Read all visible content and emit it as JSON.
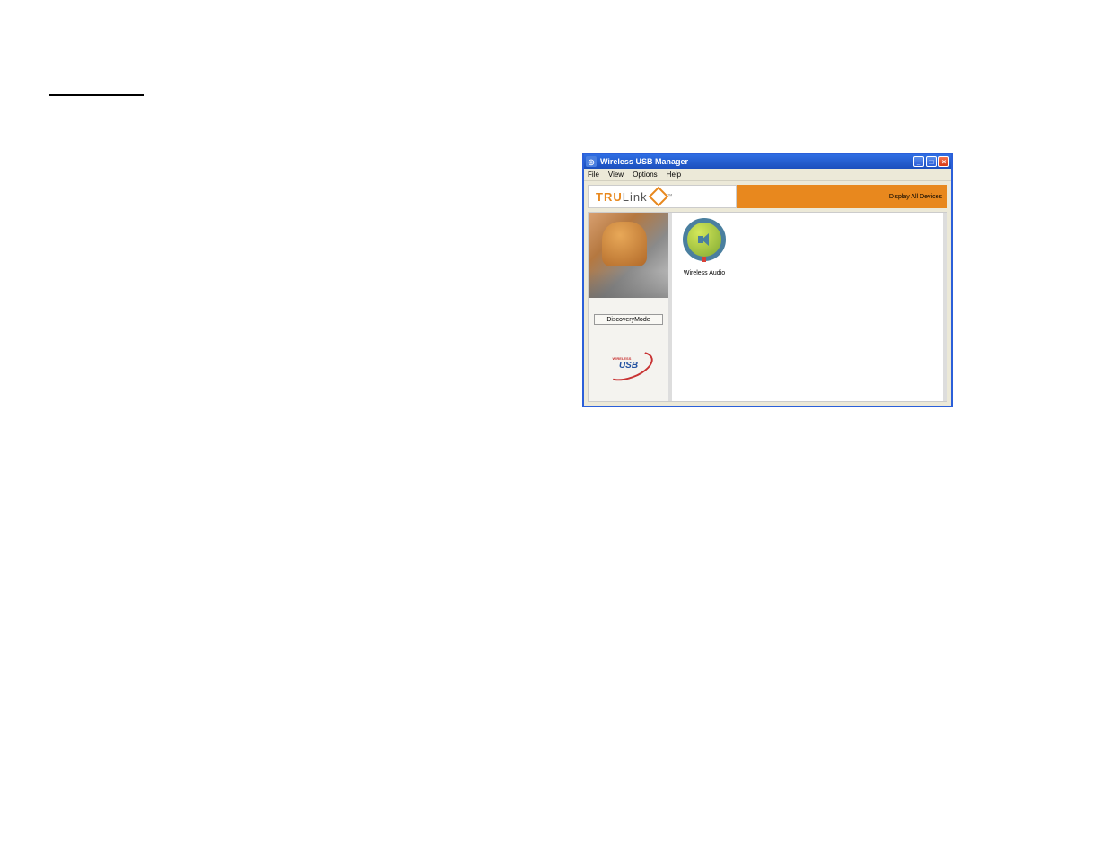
{
  "window": {
    "title": "Wireless USB Manager"
  },
  "menu": {
    "file": "File",
    "view": "View",
    "options": "Options",
    "help": "Help"
  },
  "brand": {
    "tru": "TRU",
    "link": "Link",
    "tm": "™"
  },
  "display_label": "Display  All Devices",
  "discovery": {
    "button": "DiscoveryMode"
  },
  "usb": {
    "small": "WIRELESS",
    "text": "USB"
  },
  "devices": [
    {
      "label": "Wireless Audio"
    }
  ]
}
